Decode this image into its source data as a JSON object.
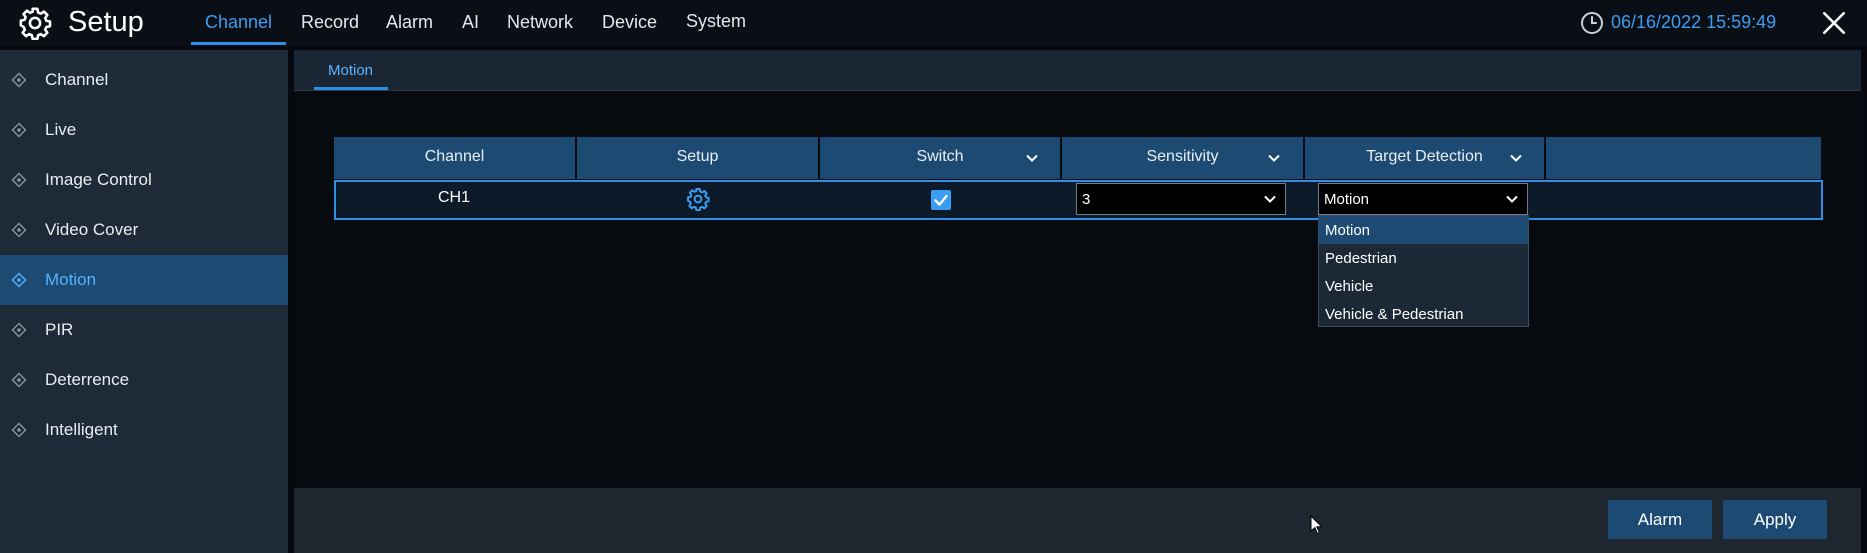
{
  "app": {
    "title": "Setup",
    "datetime": "06/16/2022 15:59:49"
  },
  "nav": {
    "tabs": [
      {
        "label": "Channel",
        "active": true
      },
      {
        "label": "Record"
      },
      {
        "label": "Alarm"
      },
      {
        "label": "AI"
      },
      {
        "label": "Network"
      },
      {
        "label": "Device"
      },
      {
        "label": "System"
      }
    ]
  },
  "sidebar": {
    "items": [
      {
        "label": "Channel"
      },
      {
        "label": "Live"
      },
      {
        "label": "Image Control"
      },
      {
        "label": "Video Cover"
      },
      {
        "label": "Motion",
        "active": true
      },
      {
        "label": "PIR"
      },
      {
        "label": "Deterrence"
      },
      {
        "label": "Intelligent"
      }
    ]
  },
  "subtabs": {
    "active": "Motion"
  },
  "table": {
    "columns": [
      "Channel",
      "Setup",
      "Switch",
      "Sensitivity",
      "Target Detection"
    ],
    "row": {
      "channel": "CH1",
      "switch_checked": true,
      "sensitivity": "3",
      "target_detection": "Motion"
    }
  },
  "dropdown": {
    "options": [
      "Motion",
      "Pedestrian",
      "Vehicle",
      "Vehicle & Pedestrian"
    ],
    "selected": "Motion"
  },
  "buttons": {
    "alarm": "Alarm",
    "apply": "Apply"
  },
  "colors": {
    "accent": "#3d9df0",
    "highlight": "#1d4a72",
    "sidebar": "#1e2a38"
  }
}
